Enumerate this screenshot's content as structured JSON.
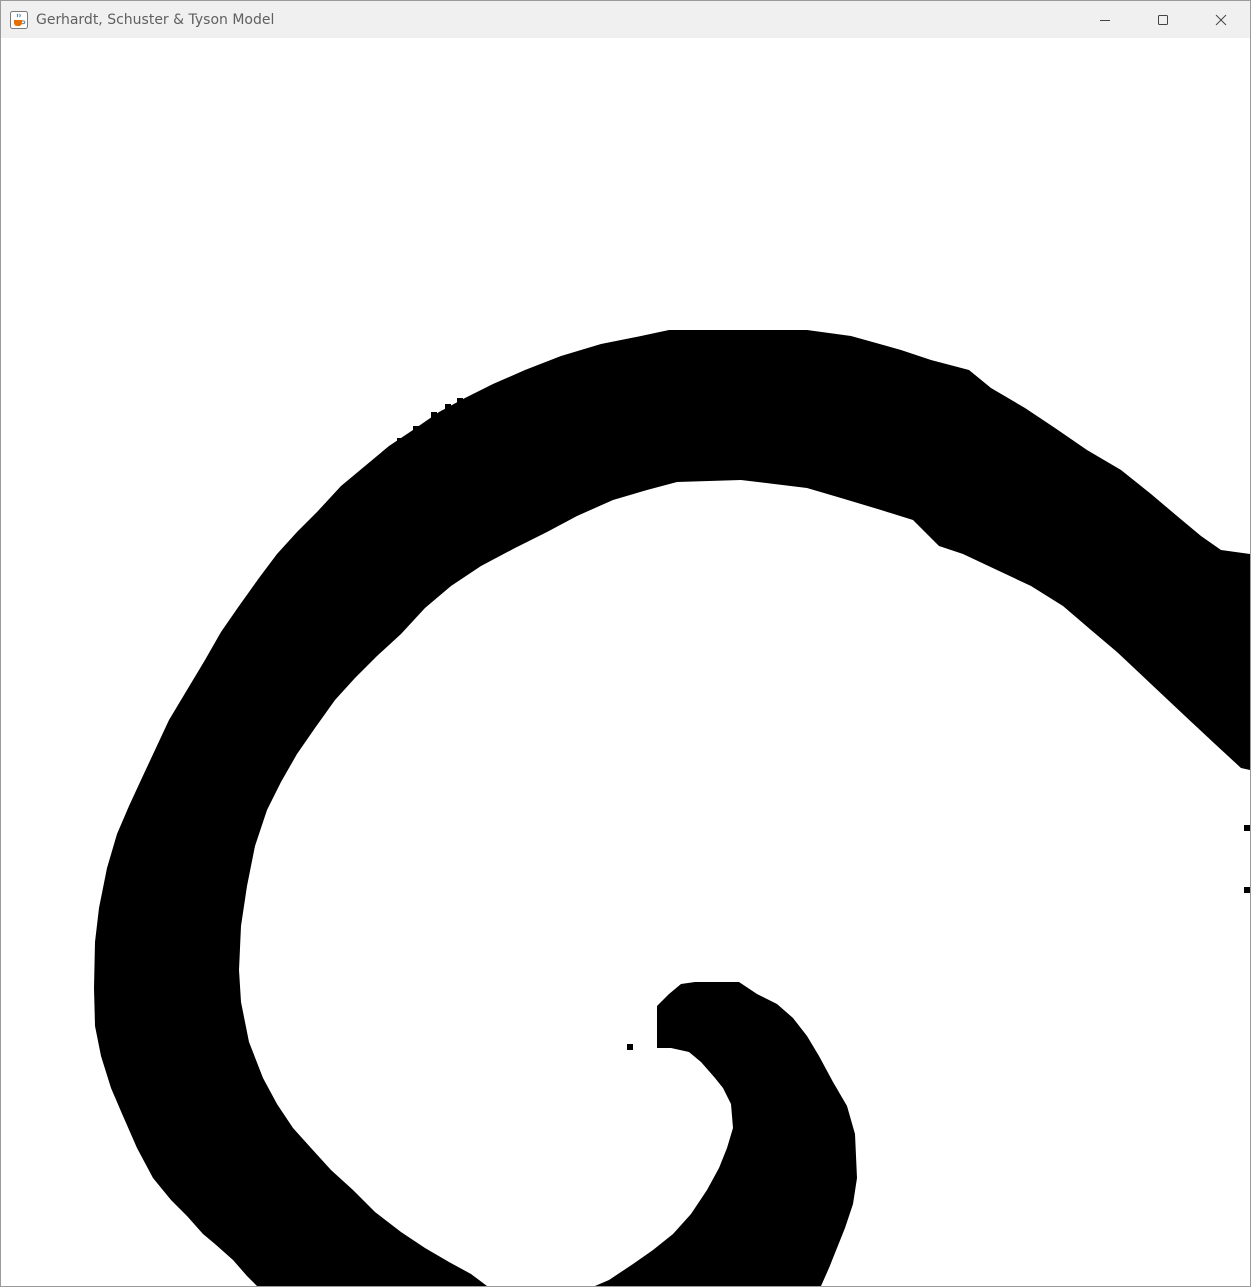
{
  "window": {
    "title": "Gerhardt, Schuster & Tyson Model",
    "app_icon": "java-coffee-cup-icon",
    "controls": {
      "minimize_icon": "minimize-icon",
      "maximize_icon": "maximize-icon",
      "close_icon": "close-icon"
    }
  },
  "simulation": {
    "foreground_color": "#000000",
    "background_color": "#ffffff"
  }
}
